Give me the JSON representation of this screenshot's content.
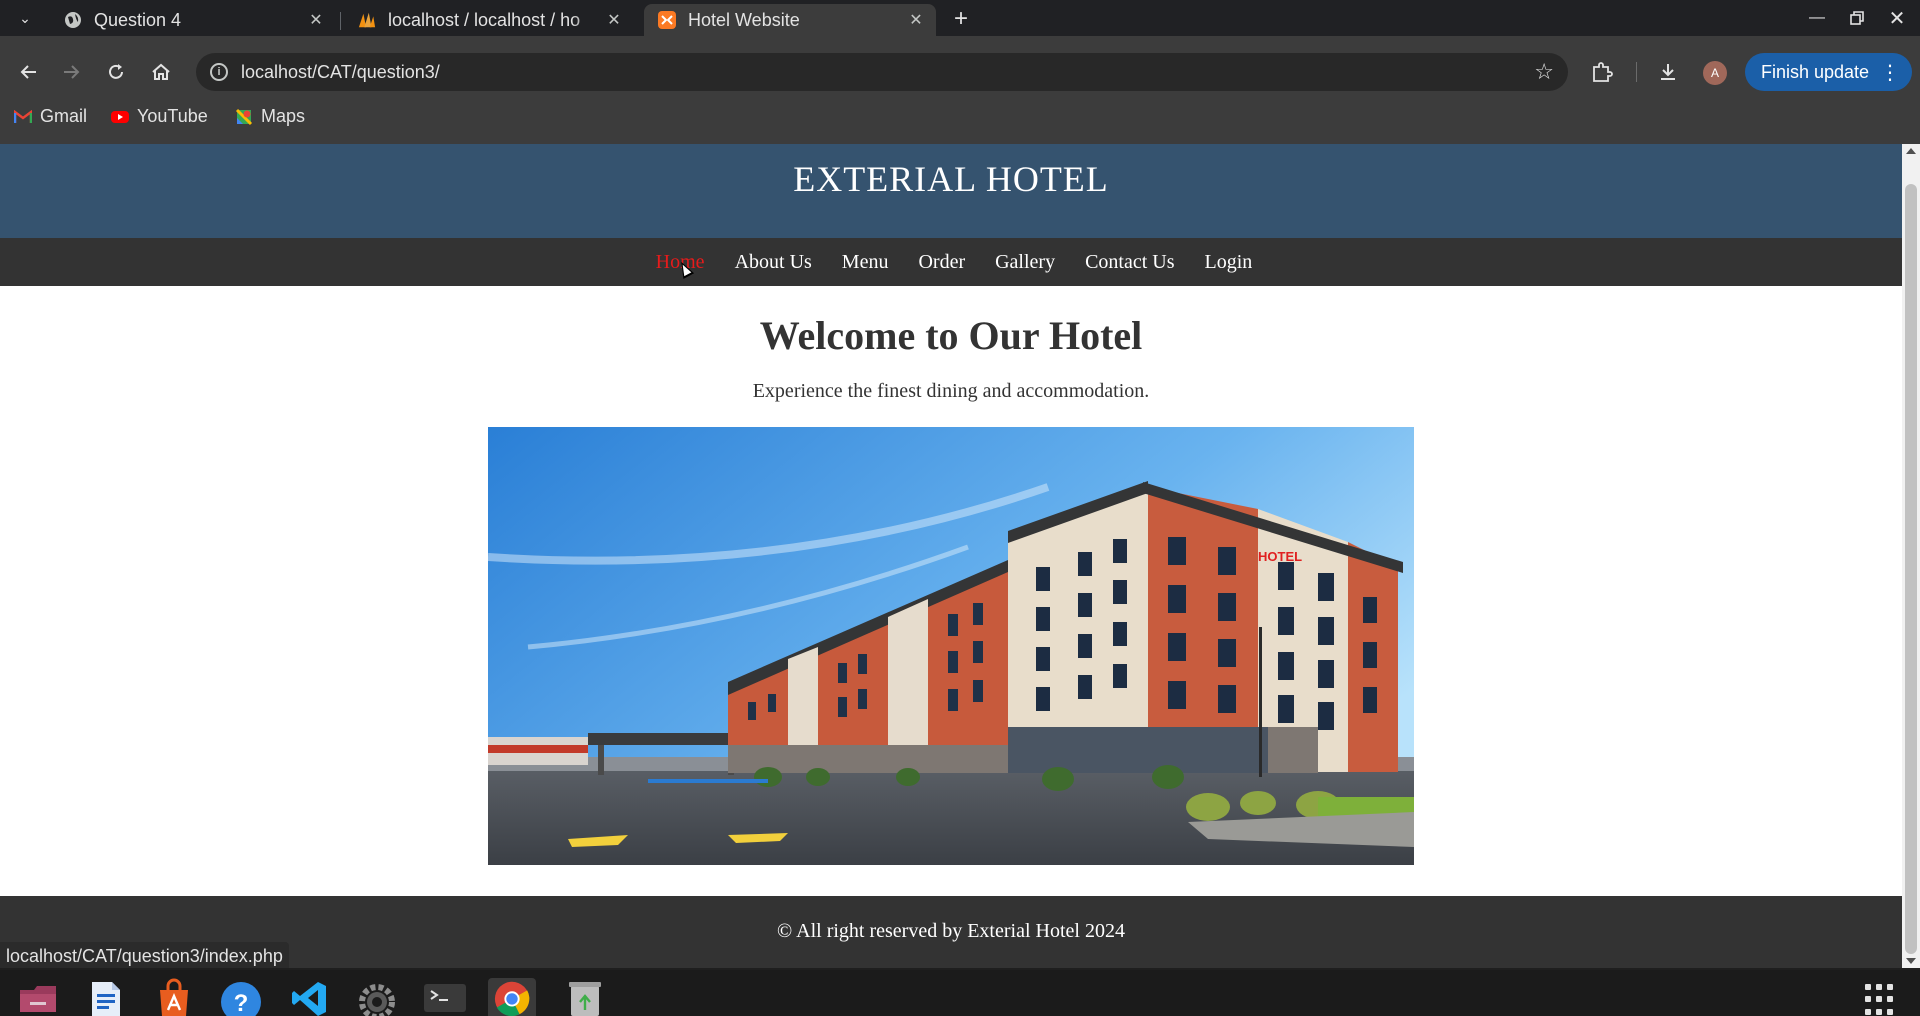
{
  "browser": {
    "tabs": [
      {
        "title": "Question 4",
        "active": false
      },
      {
        "title": "localhost / localhost / ho",
        "active": false
      },
      {
        "title": "Hotel Website",
        "active": true
      }
    ],
    "address": "localhost/CAT/question3/",
    "bookmarks": [
      "Gmail",
      "YouTube",
      "Maps"
    ],
    "profile_initial": "A",
    "update_button": "Finish update",
    "status_url": "localhost/CAT/question3/index.php"
  },
  "site": {
    "title": "EXTERIAL HOTEL",
    "nav": [
      "Home",
      "About Us",
      "Menu",
      "Order",
      "Gallery",
      "Contact Us",
      "Login"
    ],
    "current_nav": "Home",
    "hero_heading": "Welcome to Our Hotel",
    "hero_subtext": "Experience the finest dining and accommodation.",
    "footer": "© All right reserved by Exterial Hotel 2024",
    "hotel_sign": "HOTEL",
    "colors": {
      "header_bg": "#35536f",
      "nav_bg": "#333333",
      "active_link": "#e61b1b",
      "footer_bg": "#333333"
    }
  },
  "icons": {
    "tab_search": "chevron-down-icon",
    "back": "arrow-left-icon",
    "forward": "arrow-right-icon",
    "reload": "reload-icon",
    "home": "home-icon",
    "site_info": "info-icon",
    "bookmark": "star-icon",
    "extensions": "puzzle-icon",
    "downloads": "download-icon"
  },
  "taskbar": [
    "files",
    "writer",
    "app-center",
    "help",
    "vscode",
    "settings",
    "terminal",
    "chrome",
    "trash"
  ]
}
